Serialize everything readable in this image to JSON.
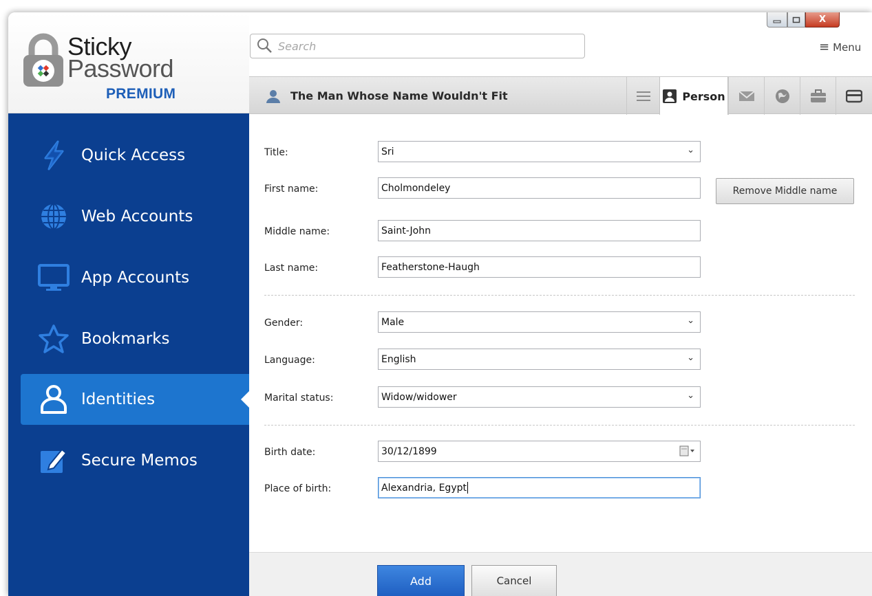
{
  "app": {
    "logo": {
      "line1": "Sticky",
      "line2": "Password",
      "edition": "PREMIUM"
    }
  },
  "window_controls": {
    "minimize_icon": "minimize-icon",
    "maximize_icon": "maximize-icon",
    "close_label": "X"
  },
  "search": {
    "placeholder": "Search",
    "value": ""
  },
  "menu": {
    "label": "Menu",
    "icon": "hamburger-icon"
  },
  "sidebar": {
    "items": [
      {
        "label": "Quick Access",
        "icon": "lightning-icon",
        "active": false
      },
      {
        "label": "Web Accounts",
        "icon": "globe-icon",
        "active": false
      },
      {
        "label": "App Accounts",
        "icon": "monitor-icon",
        "active": false
      },
      {
        "label": "Bookmarks",
        "icon": "star-icon",
        "active": false
      },
      {
        "label": "Identities",
        "icon": "person-icon",
        "active": true
      },
      {
        "label": "Secure Memos",
        "icon": "memo-icon",
        "active": false
      }
    ]
  },
  "entry": {
    "title": "The Man Whose Name Wouldn't Fit",
    "icon": "person-icon"
  },
  "tabs": [
    {
      "id": "list",
      "label": "",
      "icon": "list-icon"
    },
    {
      "id": "person",
      "label": "Person",
      "icon": "id-card-icon",
      "active": true
    },
    {
      "id": "email",
      "label": "",
      "icon": "envelope-icon"
    },
    {
      "id": "web",
      "label": "",
      "icon": "globe-icon"
    },
    {
      "id": "company",
      "label": "",
      "icon": "briefcase-icon"
    },
    {
      "id": "card",
      "label": "",
      "icon": "credit-card-icon"
    }
  ],
  "form": {
    "title": {
      "label": "Title:",
      "value": "Sri"
    },
    "first_name": {
      "label": "First name:",
      "value": "Cholmondeley"
    },
    "middle_name": {
      "label": "Middle name:",
      "value": "Saint-John"
    },
    "last_name": {
      "label": "Last name:",
      "value": "Featherstone-Haugh"
    },
    "gender": {
      "label": "Gender:",
      "value": "Male"
    },
    "language": {
      "label": "Language:",
      "value": "English"
    },
    "marital_status": {
      "label": "Marital status:",
      "value": "Widow/widower"
    },
    "birth_date": {
      "label": "Birth date:",
      "value": "30/12/1899"
    },
    "place_of_birth": {
      "label": "Place of birth:",
      "value": "Alexandria, Egypt"
    },
    "remove_middle_label": "Remove Middle name"
  },
  "footer": {
    "add_label": "Add",
    "cancel_label": "Cancel"
  },
  "colors": {
    "sidebar_bg": "#0b3f90",
    "sidebar_active": "#1d75cf",
    "brand_blue": "#1e5fb8",
    "add_button": "#2a6fd0"
  }
}
